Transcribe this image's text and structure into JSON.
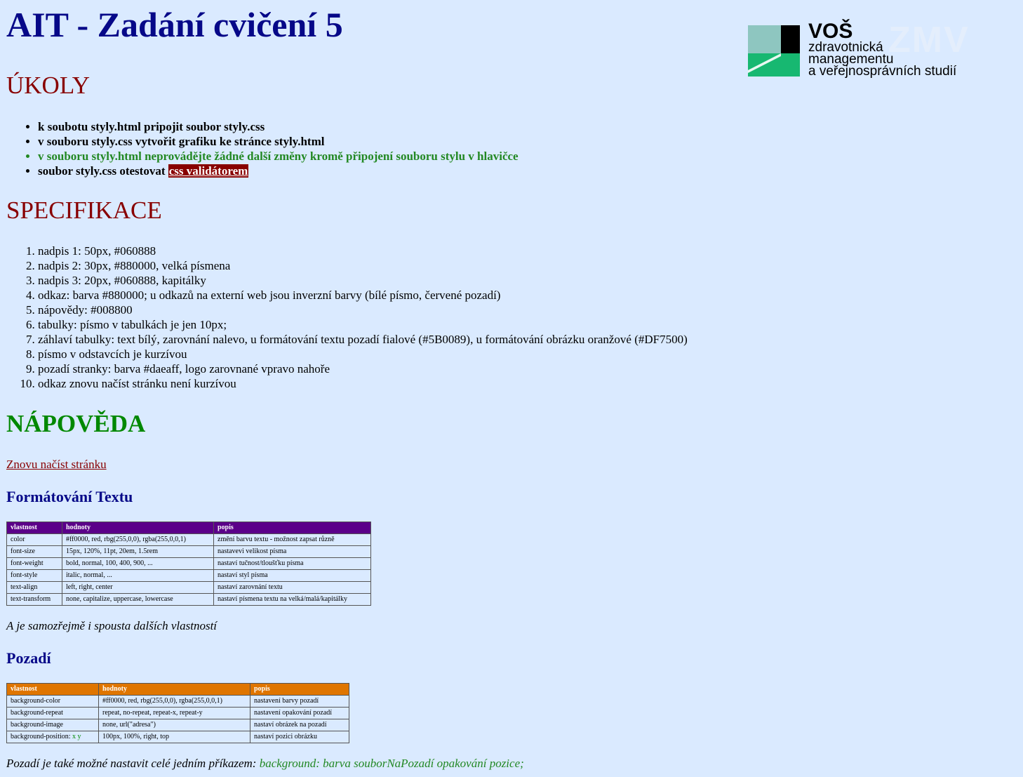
{
  "title": "AIT - Zadání cvičení 5",
  "logo": {
    "name": "VOŠ",
    "lines": [
      "zdravotnická",
      "managementu",
      "a veřejnosprávních studií"
    ]
  },
  "ukoly": {
    "heading": "Úkoly",
    "items": [
      "k soubotu styly.html pripojit soubor styly.css",
      "v souboru styly.css vytvořit grafiku ke stránce styly.html",
      "v souboru styly.html neprovádějte žádné další změny kromě připojení souboru stylu v hlavičce",
      "soubor styly.css otestovat "
    ],
    "validator_link": "css validátorem"
  },
  "specifikace": {
    "heading": "Specifikace",
    "items": [
      "nadpis 1: 50px, #060888",
      "nadpis 2: 30px, #880000, velká písmena",
      "nadpis 3: 20px, #060888, kapitálky",
      "odkaz: barva #880000; u odkazů na externí web jsou inverzní barvy (bílé písmo, červené pozadí)",
      "nápovědy: #008800",
      "tabulky: písmo v tabulkách je jen 10px;",
      "záhlaví tabulky: text bílý, zarovnání nalevo, u formátování textu pozadí fialové (#5B0089), u formátování obrázku oranžové (#DF7500)",
      "písmo v odstavcích je kurzívou",
      "pozadí stranky: barva #daeaff, logo zarovnané vpravo nahoře",
      "odkaz znovu načíst stránku není kurzívou"
    ]
  },
  "napoveda": {
    "heading": "Nápověda",
    "reload_link": "Znovu načíst stránku"
  },
  "text_section": {
    "heading": "Formátování Textu",
    "columns": [
      "vlastnost",
      "hodnoty",
      "popis"
    ],
    "rows": [
      [
        "color",
        "#ff0000, red, rbg(255,0,0), rgba(255,0,0,1)",
        "změní barvu textu - možnost zapsat různě"
      ],
      [
        "font-size",
        "15px, 120%, 11pt, 20em, 1.5rem",
        "nastavevi velikost písma"
      ],
      [
        "font-weight",
        "bold, normal, 100, 400, 900, ...",
        "nastaví tučnost/tloušťku písma"
      ],
      [
        "font-style",
        "italic, normal, ...",
        "nastaví styl písma"
      ],
      [
        "text-align",
        "left, right, center",
        "nastaví zarovnání textu"
      ],
      [
        "text-transform",
        "none, capitalize, uppercase, lowercase",
        "nastaví písmena textu na velká/malá/kapitálky"
      ]
    ],
    "note": "A je samozřejmě i spousta dalších vlastností"
  },
  "bg_section": {
    "heading": "Pozadí",
    "columns": [
      "vlastnost",
      "hodnoty",
      "popis"
    ],
    "rows": [
      [
        "background-color",
        "#ff0000, red, rbg(255,0,0), rgba(255,0,0,1)",
        "nastavení barvy pozadí"
      ],
      [
        "background-repeat",
        "repeat, no-repeat, repeat-x, repeat-y",
        "nastavení opakování pozadí"
      ],
      [
        "background-image",
        "none, url(\"adresa\")",
        "nastaví obrázek na pozadí"
      ],
      [
        "background-position: ",
        "100px, 100%, right, top",
        "nastaví pozici obrázku"
      ]
    ],
    "position_suffix": "x y",
    "note": "Pozadí je také možné nastavit celé jedním příkazem: ",
    "note_cmd": "background: barva souborNaPozadí opakování pozice;"
  }
}
